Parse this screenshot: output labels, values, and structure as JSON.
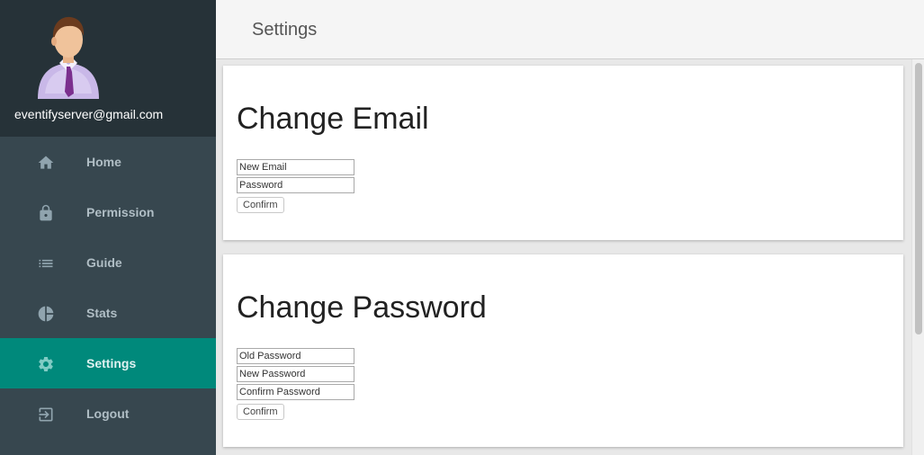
{
  "profile": {
    "email": "eventifyserver@gmail.com"
  },
  "sidebar": {
    "items": [
      {
        "label": "Home",
        "icon": "home-icon"
      },
      {
        "label": "Permission",
        "icon": "lock-icon"
      },
      {
        "label": "Guide",
        "icon": "list-icon"
      },
      {
        "label": "Stats",
        "icon": "pie-chart-icon"
      },
      {
        "label": "Settings",
        "icon": "gear-icon",
        "active": true
      },
      {
        "label": "Logout",
        "icon": "logout-icon"
      }
    ]
  },
  "header": {
    "title": "Settings"
  },
  "change_email": {
    "title": "Change Email",
    "new_email_placeholder": "New Email",
    "password_placeholder": "Password",
    "confirm_label": "Confirm"
  },
  "change_password": {
    "title": "Change Password",
    "old_password_placeholder": "Old Password",
    "new_password_placeholder": "New Password",
    "confirm_password_placeholder": "Confirm Password",
    "confirm_label": "Confirm"
  },
  "colors": {
    "sidebar_bg": "#37474f",
    "profile_bg": "#263238",
    "active_item": "#00897b",
    "nav_text": "#b0bec5"
  }
}
